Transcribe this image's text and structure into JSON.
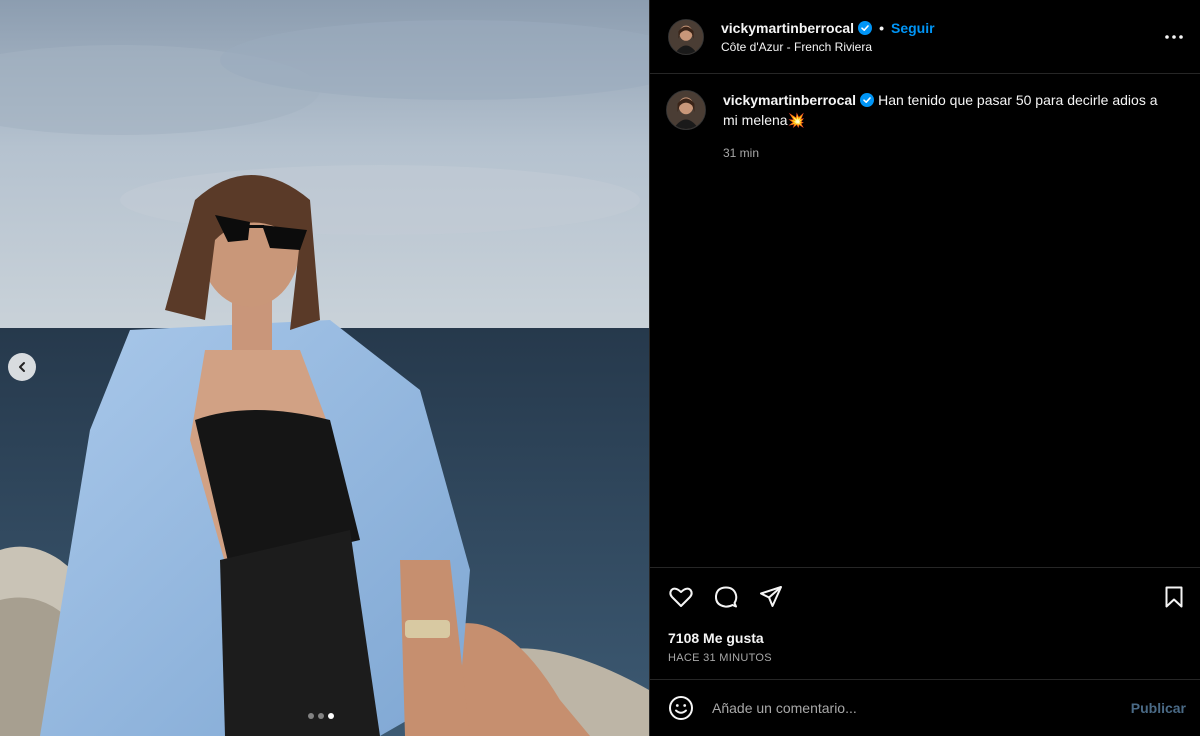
{
  "post": {
    "username": "vickymartinberrocal",
    "separator": "•",
    "follow_label": "Seguir",
    "location": "Côte d'Azur - French Riviera",
    "caption": "Han tenido que pasar 50 para decirle adios a mi melena💥",
    "caption_time": "31 min",
    "likes": "7108 Me gusta",
    "posted_ago": "HACE 31 MINUTOS"
  },
  "comment_box": {
    "placeholder": "Añade un comentario...",
    "publish_label": "Publicar"
  },
  "carousel": {
    "slide_count": 3,
    "active_index": 2
  },
  "colors": {
    "accent": "#0095f6",
    "verified": "#0095f6",
    "background": "#000000"
  },
  "icons": [
    "heart-icon",
    "comment-icon",
    "share-icon",
    "bookmark-icon",
    "emoji-icon",
    "more-icon",
    "chevron-left-icon",
    "verified-icon"
  ]
}
